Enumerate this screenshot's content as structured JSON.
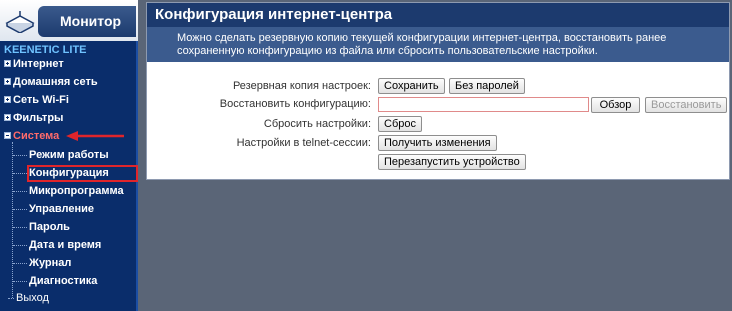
{
  "brand": {
    "header_label": "Монитор",
    "model": "KEENETIC LITE",
    "icon": "router-icon"
  },
  "sidebar": {
    "top_items": [
      {
        "label": "Интернет"
      },
      {
        "label": "Домашняя сеть"
      },
      {
        "label": "Сеть Wi-Fi"
      },
      {
        "label": "Фильтры"
      },
      {
        "label": "Система"
      }
    ],
    "system_items": [
      {
        "label": "Режим работы"
      },
      {
        "label": "Конфигурация"
      },
      {
        "label": "Микропрограмма"
      },
      {
        "label": "Управление"
      },
      {
        "label": "Пароль"
      },
      {
        "label": "Дата и время"
      },
      {
        "label": "Журнал"
      },
      {
        "label": "Диагностика"
      }
    ],
    "exit_label": "Выход",
    "active_item": "Конфигурация",
    "accent_color": "#e0252b"
  },
  "main": {
    "title": "Конфигурация интернет-центра",
    "description": "Можно сделать резервную копию текущей конфигурации интернет-центра, восстановить ранее сохраненную конфигурацию из файла или сбросить пользовательские настройки.",
    "rows": {
      "backup": {
        "label": "Резервная копия настроек:",
        "save_button": "Сохранить",
        "no_passwords_button": "Без паролей"
      },
      "restore": {
        "label": "Восстановить конфигурацию:",
        "file_value": "",
        "browse_button": "Обзор",
        "restore_button": "Восстановить"
      },
      "reset": {
        "label": "Сбросить настройки:",
        "reset_button": "Сброс"
      },
      "telnet": {
        "label": "Настройки в telnet-сессии:",
        "get_changes_button": "Получить изменения",
        "restart_button": "Перезапустить устройство"
      }
    }
  }
}
